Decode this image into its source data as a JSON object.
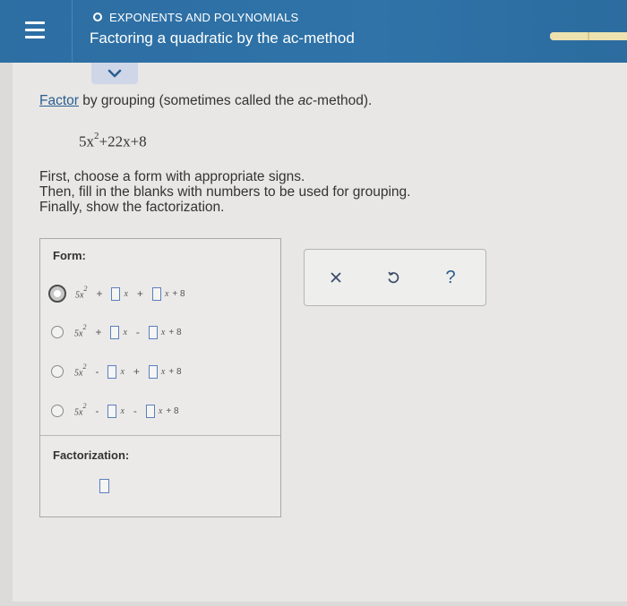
{
  "header": {
    "topic": "EXPONENTS AND POLYNOMIALS",
    "title": "Factoring a quadratic by the ac-method",
    "progress_fraction": 1.0
  },
  "instruction": {
    "link": "Factor",
    "text_before_italic": " by grouping (sometimes called the ",
    "italic": "ac",
    "text_after_italic": "-method)."
  },
  "expression": {
    "lead": "5x",
    "exponent": "2",
    "rest": "+22x+8"
  },
  "steps": [
    "First, choose a form with appropriate signs.",
    "Then, fill in the blanks with numbers to be used for grouping.",
    "Finally, show the factorization."
  ],
  "form": {
    "label": "Form:",
    "selected_index": 0,
    "options": [
      {
        "term": "5x",
        "exp": "2",
        "op1": "+",
        "var": "x",
        "op2": "+",
        "const": "+ 8"
      },
      {
        "term": "5x",
        "exp": "2",
        "op1": "+",
        "var": "x",
        "op2": "-",
        "const": "+ 8"
      },
      {
        "term": "5x",
        "exp": "2",
        "op1": "-",
        "var": "x",
        "op2": "+",
        "const": "+ 8"
      },
      {
        "term": "5x",
        "exp": "2",
        "op1": "-",
        "var": "x",
        "op2": "-",
        "const": "+ 8"
      }
    ]
  },
  "factorization": {
    "label": "Factorization:"
  },
  "colors": {
    "header_blue": "#2f73a8",
    "link_blue": "#2a5d8f",
    "blank_border": "#5b7fc0"
  },
  "tools": {
    "clear": "×",
    "undo": "undo-icon",
    "help": "?"
  }
}
